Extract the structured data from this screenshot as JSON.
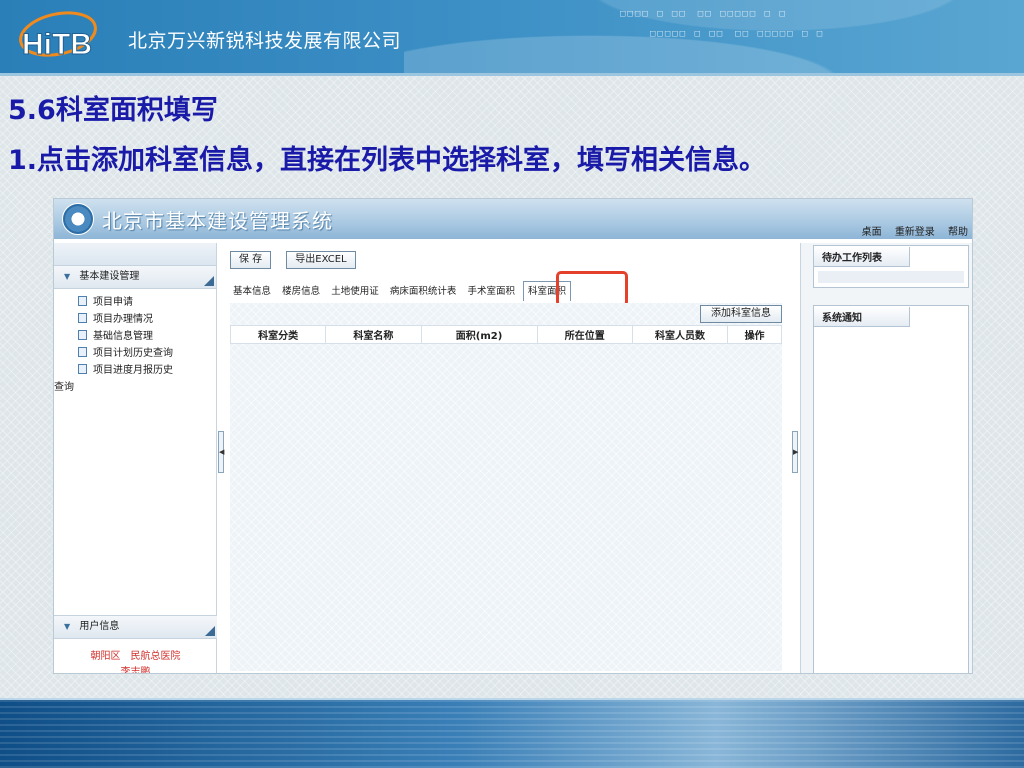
{
  "slide": {
    "company_name": "北京万兴新锐科技发展有限公司",
    "logo_text": "HiTB",
    "title": "5.6科室面积填写",
    "instruction": "1.点击添加科室信息，直接在列表中选择科室，填写相关信息。"
  },
  "app": {
    "title": "北京市基本建设管理系统",
    "top_links": [
      "桌面",
      "重新登录",
      "帮助"
    ],
    "sidebar": {
      "section_main": "基本建设管理",
      "items": [
        "项目申请",
        "项目办理情况",
        "基础信息管理",
        "项目计划历史查询",
        "项目进度月报历史"
      ],
      "item_tail": "查询",
      "section_user": "用户信息",
      "user_district": "朝阳区　民航总医院",
      "user_name": "李志鹏"
    },
    "toolbar": {
      "save_label": "保 存",
      "export_label": "导出EXCEL"
    },
    "tabs": [
      "基本信息",
      "楼房信息",
      "土地使用证",
      "病床面积统计表",
      "手术室面积",
      "科室面积"
    ],
    "active_tab": "科室面积",
    "add_button": "添加科室信息",
    "table_headers": [
      "科室分类",
      "科室名称",
      "面积(m2)",
      "所在位置",
      "科室人员数",
      "操作"
    ],
    "right_panel": {
      "todo_title": "待办工作列表",
      "notice_title": "系统通知"
    }
  }
}
